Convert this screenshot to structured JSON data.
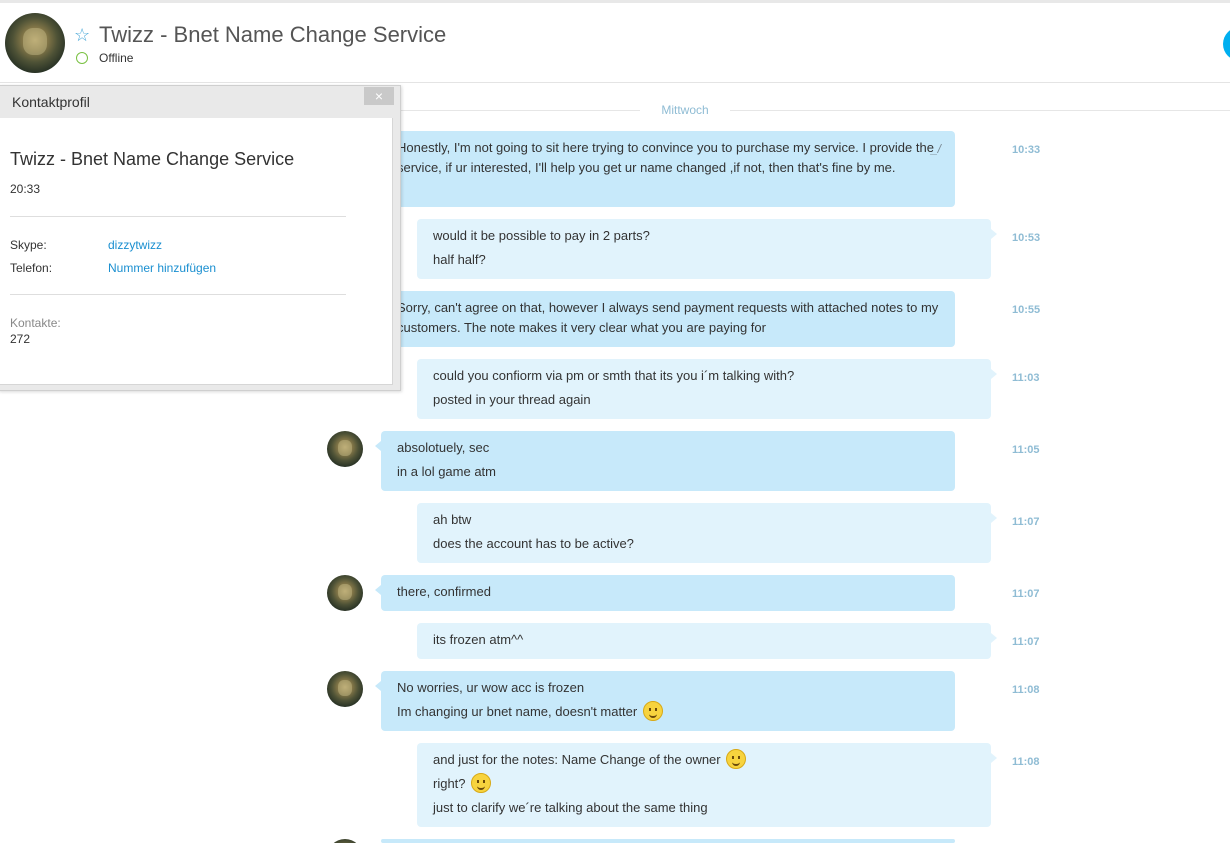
{
  "header": {
    "title": "Twizz - Bnet Name Change Service",
    "status": "Offline"
  },
  "conversation": {
    "date_label": "Mittwoch",
    "messages": [
      {
        "sender": "them",
        "lines": [
          "Honestly, I'm not going to sit here trying to convince you to purchase my service. I provide the service, if ur interested, I'll help you get ur name changed ,if not, then that's fine by me."
        ],
        "time": "10:33",
        "edited": true
      },
      {
        "sender": "me",
        "lines": [
          "would it be possible to pay in 2 parts?",
          "half half?"
        ],
        "time": "10:53"
      },
      {
        "sender": "them",
        "lines": [
          "Sorry, can't agree on that, however I always send payment requests with attached notes to my customers. The note makes it very clear what you are paying for"
        ],
        "time": "10:55"
      },
      {
        "sender": "me",
        "lines": [
          "could you confiorm via pm or smth that its you i´m talking with?",
          "posted in your thread again"
        ],
        "time": "11:03"
      },
      {
        "sender": "them",
        "lines": [
          "absolotuely, sec",
          "in a lol game atm"
        ],
        "time": "11:05"
      },
      {
        "sender": "me",
        "lines": [
          "ah btw",
          "does the account has to be active?"
        ],
        "time": "11:07"
      },
      {
        "sender": "them",
        "lines": [
          "there, confirmed"
        ],
        "time": "11:07"
      },
      {
        "sender": "me",
        "lines": [
          "its frozen atm^^"
        ],
        "time": "11:07"
      },
      {
        "sender": "them",
        "lines": [
          "No worries, ur wow acc is frozen",
          "Im changing ur bnet name, doesn't matter"
        ],
        "time": "11:08"
      },
      {
        "sender": "me",
        "lines": [
          "and just for the notes: Name Change of the owner",
          "right?",
          "just to clarify we´re talking about the same thing"
        ],
        "time": "11:08"
      }
    ]
  },
  "profile_panel": {
    "title": "Kontaktprofil",
    "close_label": "×",
    "name": "Twizz - Bnet Name Change Service",
    "local_time": "20:33",
    "skype_label": "Skype:",
    "skype_value": "dizzytwizz",
    "phone_label": "Telefon:",
    "phone_value": "Nummer hinzufügen",
    "contacts_label": "Kontakte:",
    "contacts_value": "272"
  },
  "icons": {
    "favorite": "star-outline-icon",
    "status": "offline-status-icon",
    "edit": "pencil-icon",
    "emoji": "smiley-icon"
  },
  "colors": {
    "accent": "#00aff0",
    "incoming_bubble": "#c7e9fa",
    "outgoing_bubble": "#e1f3fc",
    "timestamp": "#8fbcd4",
    "link": "#1a8fd0",
    "status_ring": "#7ac143"
  }
}
